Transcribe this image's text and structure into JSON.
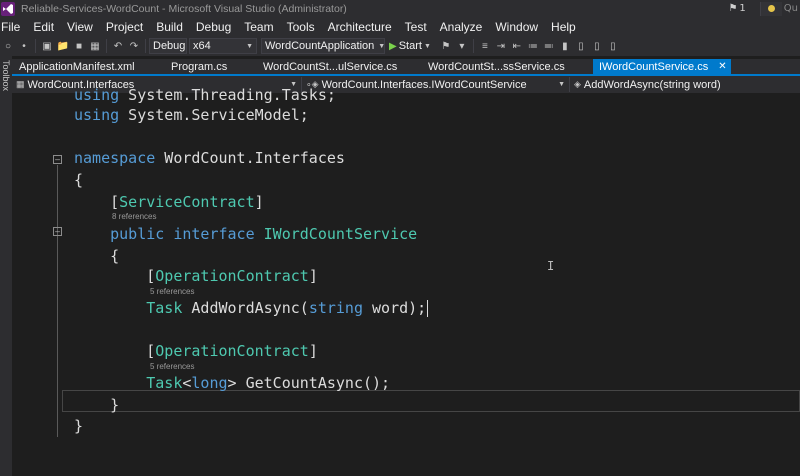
{
  "window": {
    "title": "Reliable-Services-WordCount - Microsoft Visual Studio (Administrator)",
    "notification_count": "1",
    "quick_launch_text": "Qu"
  },
  "menu": [
    "File",
    "Edit",
    "View",
    "Project",
    "Build",
    "Debug",
    "Team",
    "Tools",
    "Architecture",
    "Test",
    "Analyze",
    "Window",
    "Help"
  ],
  "toolbar": {
    "configuration": "Debug",
    "platform": "x64",
    "startup_project": "WordCountApplication",
    "start_label": "Start"
  },
  "tabs": [
    {
      "label": "ApplicationManifest.xml",
      "active": false
    },
    {
      "label": "Program.cs",
      "active": false
    },
    {
      "label": "WordCountSt...ulService.cs",
      "active": false
    },
    {
      "label": "WordCountSt...ssService.cs",
      "active": false
    },
    {
      "label": "IWordCountService.cs",
      "active": true
    }
  ],
  "side_panel": {
    "toolbox_label": "Toolbox"
  },
  "navbar": {
    "project": "WordCount.Interfaces",
    "type": "WordCount.Interfaces.IWordCountService",
    "member": "AddWordAsync(string word)"
  },
  "code": {
    "line_using_tasks": [
      "using",
      " System.Threading.Tasks;"
    ],
    "line_using_servicemodel": [
      "using",
      " System.ServiceModel;"
    ],
    "line_namespace": [
      "namespace",
      " WordCount.Interfaces"
    ],
    "open_brace": "{",
    "close_brace": "}",
    "attr_service_contract": "ServiceContract",
    "lens_interface": "8 references",
    "line_interface": [
      "public",
      "interface",
      "IWordCountService"
    ],
    "attr_operation_contract": "OperationContract",
    "lens_addword": "5 references",
    "line_addword": [
      "Task",
      " AddWordAsync(",
      "string",
      " word);"
    ],
    "lens_getcount": "5 references",
    "line_getcount": [
      "Task",
      "<",
      "long",
      "> GetCountAsync();"
    ]
  },
  "colors": {
    "accent": "#007acc",
    "keyword": "#569cd6",
    "type": "#4ec9b0",
    "background": "#1e1e1e",
    "chrome": "#2d2d30"
  }
}
